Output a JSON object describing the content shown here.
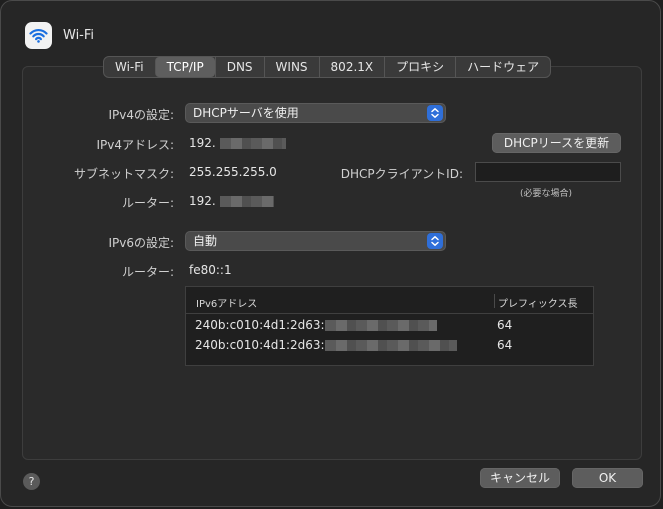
{
  "header": {
    "title": "Wi-Fi",
    "icon": "wifi-icon"
  },
  "tabs": [
    {
      "label": "Wi-Fi",
      "active": false
    },
    {
      "label": "TCP/IP",
      "active": true
    },
    {
      "label": "DNS",
      "active": false
    },
    {
      "label": "WINS",
      "active": false
    },
    {
      "label": "802.1X",
      "active": false
    },
    {
      "label": "プロキシ",
      "active": false
    },
    {
      "label": "ハードウェア",
      "active": false
    }
  ],
  "ipv4": {
    "config_label": "IPv4の設定:",
    "config_value": "DHCPサーバを使用",
    "address_label": "IPv4アドレス:",
    "address_value": "192.",
    "subnet_label": "サブネットマスク:",
    "subnet_value": "255.255.255.0",
    "router_label": "ルーター:",
    "router_value": "192."
  },
  "dhcp": {
    "renew_button": "DHCPリースを更新",
    "client_id_label": "DHCPクライアントID:",
    "client_id_value": "",
    "client_id_hint": "(必要な場合)"
  },
  "ipv6": {
    "config_label": "IPv6の設定:",
    "config_value": "自動",
    "router_label": "ルーター:",
    "router_value": "fe80::1",
    "table": {
      "col_address": "IPv6アドレス",
      "col_prefix": "プレフィックス長",
      "rows": [
        {
          "address": "240b:c010:4d1:2d63:",
          "prefix": "64"
        },
        {
          "address": "240b:c010:4d1:2d63:",
          "prefix": "64"
        }
      ]
    }
  },
  "footer": {
    "help": "?",
    "cancel": "キャンセル",
    "ok": "OK"
  },
  "colors": {
    "accent": "#2f6fd9",
    "window_bg": "#262626",
    "panel_bg": "#2a2a2a"
  }
}
